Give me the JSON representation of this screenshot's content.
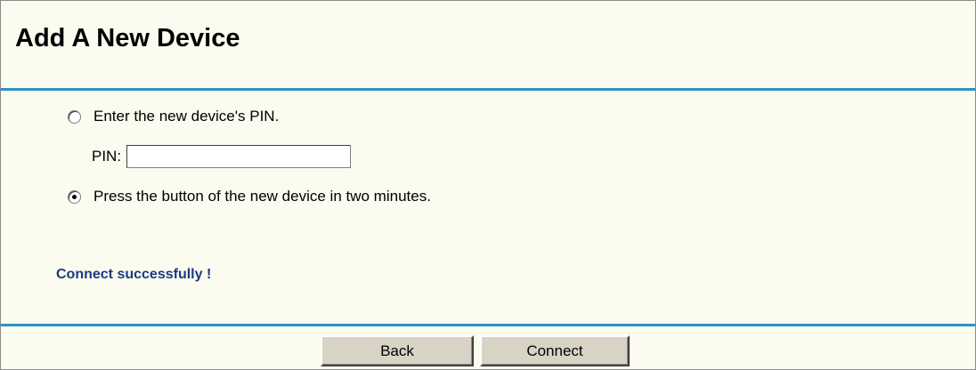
{
  "page": {
    "title": "Add A New Device"
  },
  "options": {
    "pin_option_label": "Enter the new device's PIN.",
    "pin_option_selected": false,
    "pin_label": "PIN:",
    "pin_value": "",
    "button_option_label": "Press the button of the new device in two minutes.",
    "button_option_selected": true
  },
  "status": {
    "message": "Connect successfully !"
  },
  "buttons": {
    "back_label": "Back",
    "connect_label": "Connect"
  },
  "colors": {
    "background": "#fbfbef",
    "rule": "#2b92c8",
    "status_text": "#1b3a82",
    "button_face": "#d8d3c5"
  }
}
